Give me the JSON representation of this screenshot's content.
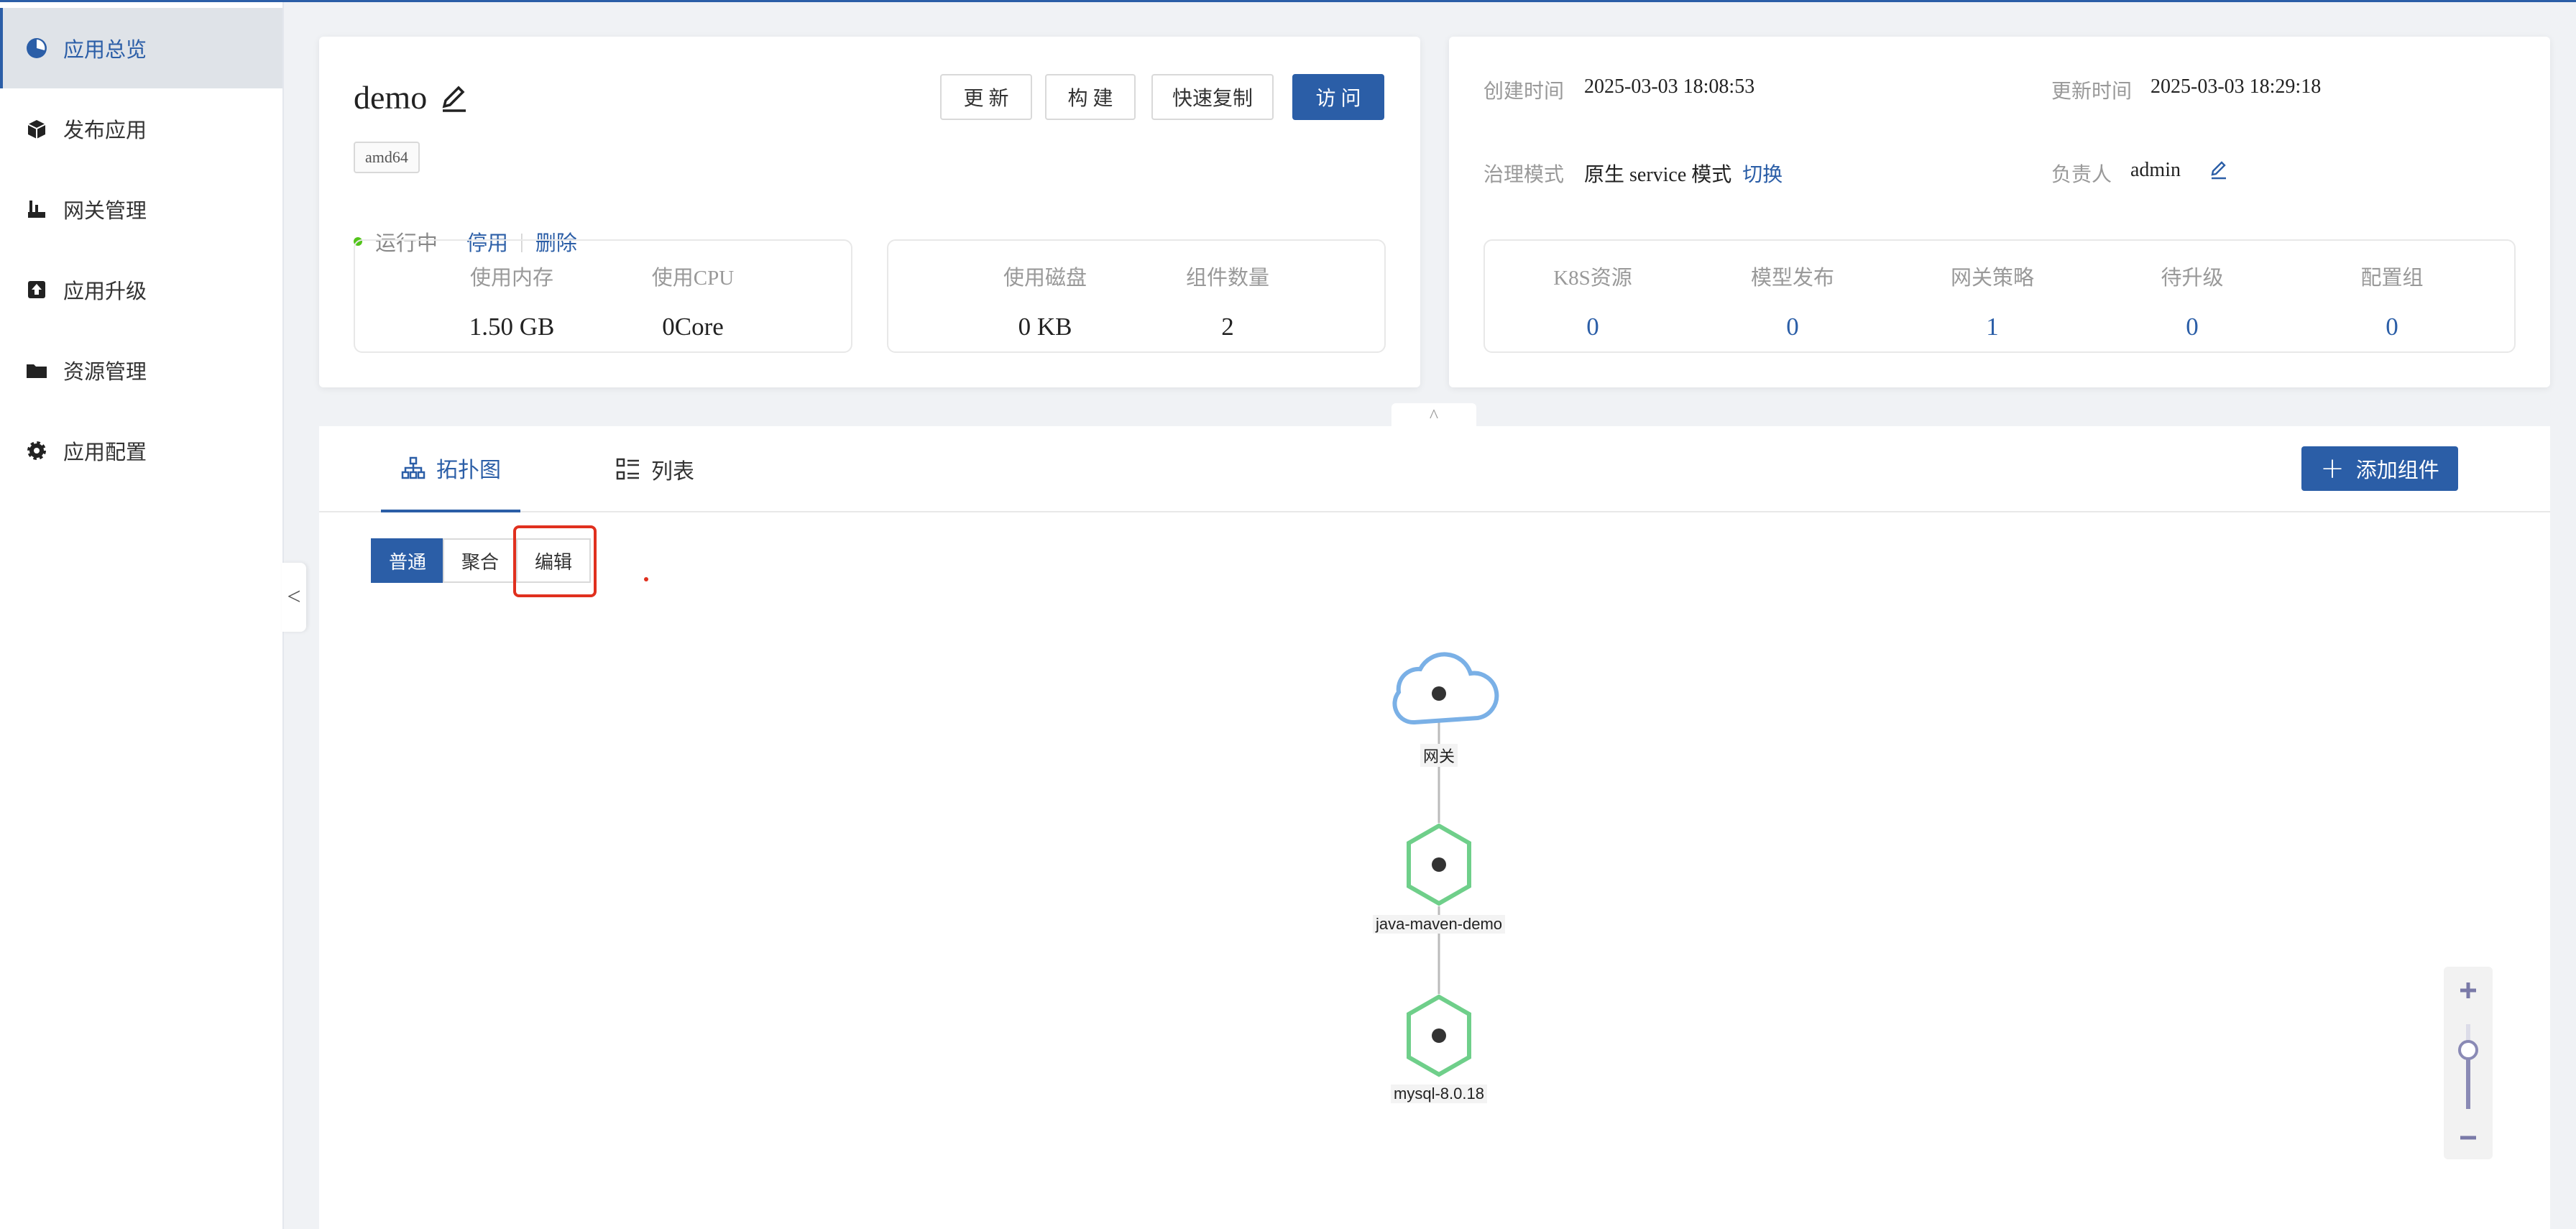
{
  "sidebar": {
    "items": [
      {
        "label": "应用总览",
        "icon": "pie-chart-icon",
        "active": true
      },
      {
        "label": "发布应用",
        "icon": "box-icon"
      },
      {
        "label": "网关管理",
        "icon": "gateway-icon"
      },
      {
        "label": "应用升级",
        "icon": "upload-icon"
      },
      {
        "label": "资源管理",
        "icon": "folder-icon"
      },
      {
        "label": "应用配置",
        "icon": "gear-icon"
      }
    ],
    "collapse_glyph": "<"
  },
  "app": {
    "name": "demo",
    "arch_tag": "amd64",
    "status": "运行中",
    "stop_label": "停用",
    "delete_label": "删除",
    "buttons": {
      "update": "更 新",
      "build": "构 建",
      "copy": "快速复制",
      "visit": "访 问"
    }
  },
  "usage": {
    "memory_label": "使用内存",
    "memory_value": "1.50 GB",
    "cpu_label": "使用CPU",
    "cpu_value": "0Core",
    "disk_label": "使用磁盘",
    "disk_value": "0 KB",
    "components_label": "组件数量",
    "components_value": "2"
  },
  "info": {
    "created_label": "创建时间",
    "created_value": "2025-03-03 18:08:53",
    "updated_label": "更新时间",
    "updated_value": "2025-03-03 18:29:18",
    "governance_label": "治理模式",
    "governance_value": "原生 service 模式",
    "switch_label": "切换",
    "owner_label": "负责人",
    "owner_value": "admin"
  },
  "resources": {
    "k8s_label": "K8S资源",
    "k8s_value": "0",
    "model_label": "模型发布",
    "model_value": "0",
    "gateway_label": "网关策略",
    "gateway_value": "1",
    "upgrade_label": "待升级",
    "upgrade_value": "0",
    "config_label": "配置组",
    "config_value": "0"
  },
  "tabs": {
    "topology": "拓扑图",
    "list": "列表",
    "add_component": "添加组件"
  },
  "view_modes": {
    "normal": "普通",
    "aggregate": "聚合",
    "edit": "编辑"
  },
  "topology": {
    "nodes": [
      {
        "label": "网关",
        "type": "cloud"
      },
      {
        "label": "java-maven-demo",
        "type": "component"
      },
      {
        "label": "mysql-8.0.18",
        "type": "component"
      }
    ],
    "colors": {
      "cloud": "#7ab0e6",
      "component": "#6fcf8a",
      "accent": "#2b5ea7",
      "highlight": "#e0301e"
    }
  },
  "zoom": {
    "plus": "+",
    "minus": "−",
    "level": 0.73
  },
  "collapse_tab_glyph": "^"
}
